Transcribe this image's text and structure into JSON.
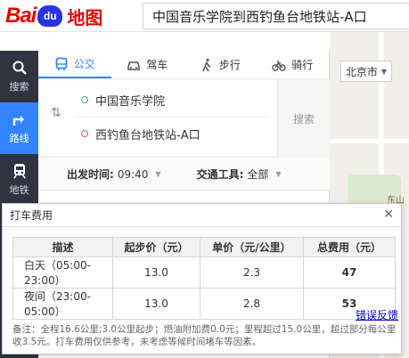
{
  "header": {
    "logo_bai": "Bai",
    "logo_du": "du",
    "logo_ditu": "地图",
    "search_value": "中国音乐学院到西钓鱼台地铁站-A口"
  },
  "leftnav": {
    "items": [
      {
        "label": "搜索",
        "icon": "search-icon"
      },
      {
        "label": "路线",
        "icon": "route-icon"
      },
      {
        "label": "地铁",
        "icon": "subway-icon"
      }
    ]
  },
  "map": {
    "city": "北京市",
    "place_label": "东山"
  },
  "route": {
    "tabs": [
      {
        "label": "公交",
        "icon": "bus-icon"
      },
      {
        "label": "驾车",
        "icon": "car-icon"
      },
      {
        "label": "步行",
        "icon": "walk-icon"
      },
      {
        "label": "骑行",
        "icon": "bike-icon"
      }
    ],
    "start": "中国音乐学院",
    "end": "西钓鱼台地铁站-A口",
    "search_label": "搜索",
    "depart_label": "出发时间:",
    "depart_value": "09:40",
    "transport_label": "交通工具:",
    "transport_value": "全部"
  },
  "taxi_modal": {
    "title": "打车费用",
    "columns": [
      "描述",
      "起步价（元）",
      "单价（元/公里）",
      "总费用（元）"
    ],
    "rows": [
      {
        "period": "白天（05:00-23:00）",
        "start_price": "13.0",
        "unit_price": "2.3",
        "total": "47"
      },
      {
        "period": "夜间（23:00-05:00）",
        "start_price": "13.0",
        "unit_price": "2.8",
        "total": "53"
      }
    ],
    "report_link": "错误反馈",
    "note": "备注：全程16.6公里;3.0公里起步；燃油附加费0.0元；里程超过15.0公里，超过部分每公里收3.5元。打车费用仅供参考，未考虑等候时间堵车等因素。"
  }
}
